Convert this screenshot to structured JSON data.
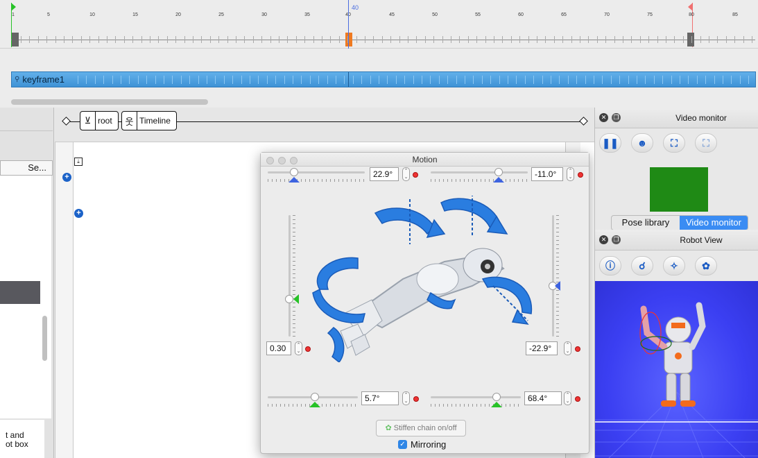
{
  "timeline": {
    "ticks": [
      "1",
      "5",
      "10",
      "15",
      "20",
      "25",
      "30",
      "35",
      "40",
      "45",
      "50",
      "55",
      "60",
      "65",
      "70",
      "75",
      "80",
      "85"
    ],
    "current_frame": "40",
    "keyframe_label": "keyframe1"
  },
  "left_panel": {
    "search_label": "Se...",
    "note_line1": "t and",
    "note_line2": "ot box"
  },
  "breadcrumb": {
    "root_label": "root",
    "timeline_label": "Timeline"
  },
  "motion_dialog": {
    "title": "Motion",
    "top_left_value": "22.9°",
    "top_right_value": "-11.0°",
    "left_value": "0.30",
    "right_value": "-22.9°",
    "bottom_left_value": "5.7°",
    "bottom_right_value": "68.4°",
    "stiffen_label": "Stiffen chain on/off",
    "mirroring_label": "Mirroring",
    "mirroring_checked": true
  },
  "video_monitor": {
    "title": "Video monitor",
    "tabs": [
      "Pose library",
      "Video monitor"
    ],
    "active_tab": "Video monitor",
    "feed_color": "#1f8a15"
  },
  "robot_view": {
    "title": "Robot View"
  },
  "colors": {
    "accent": "#3a8cf3",
    "keyframe_bar": "#4fa3e3",
    "playhead_current": "#ef7a20"
  }
}
